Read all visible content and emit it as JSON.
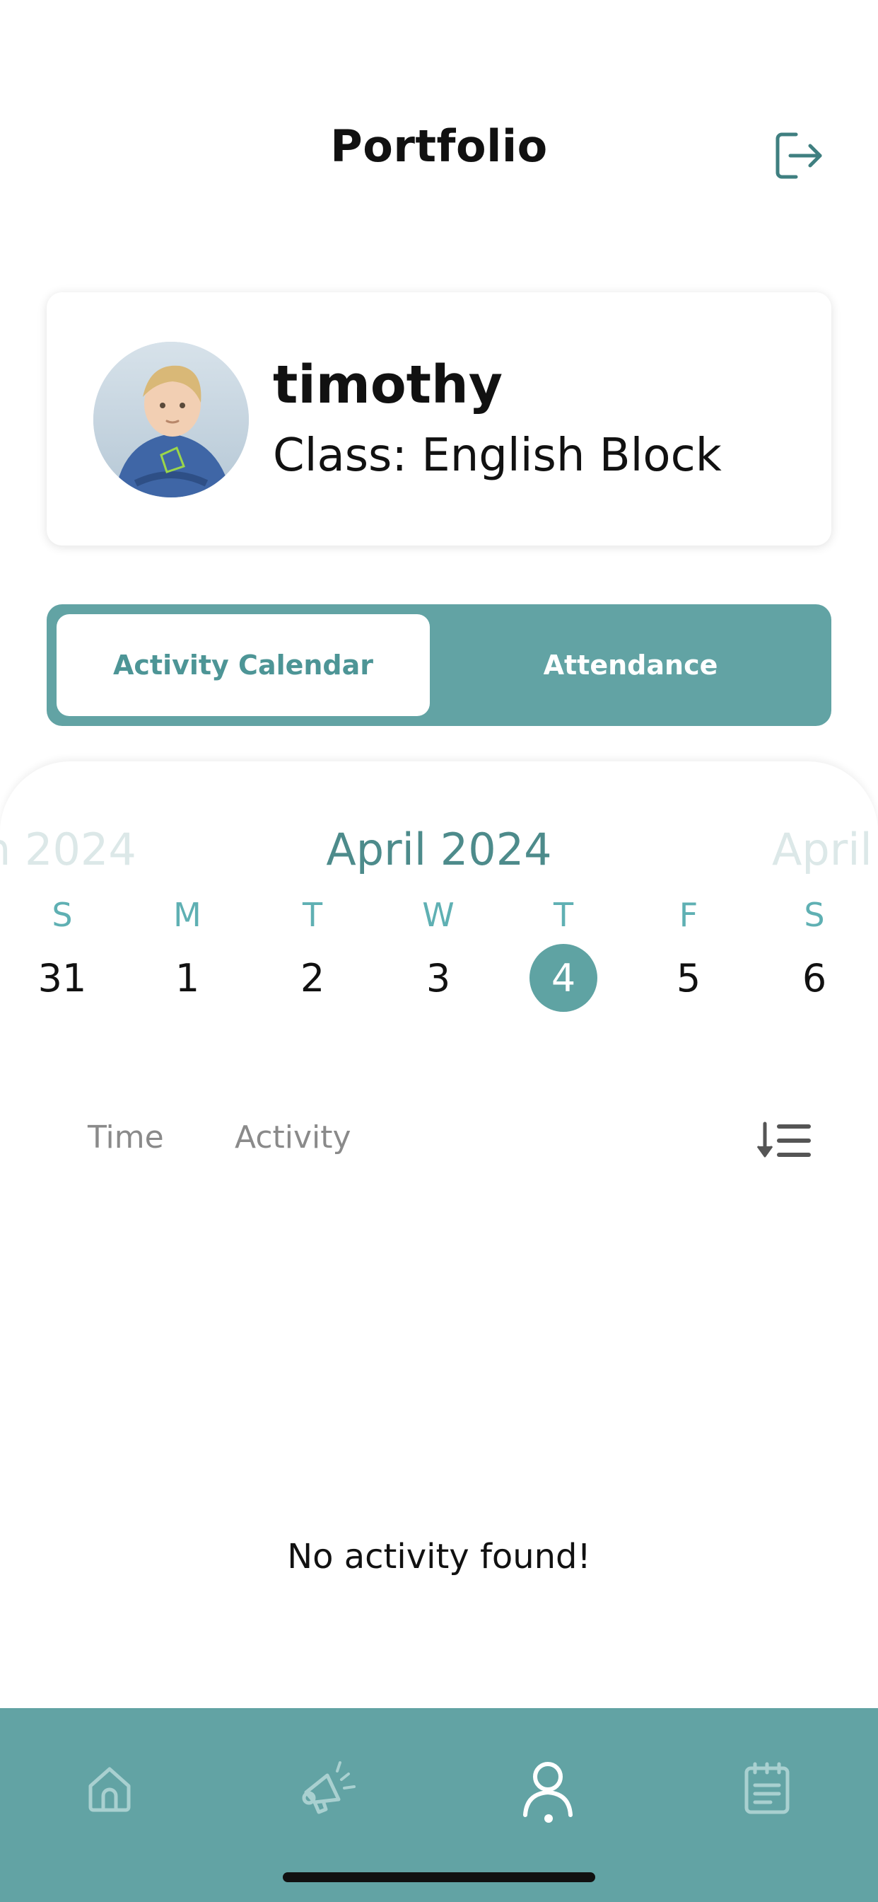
{
  "header": {
    "title": "Portfolio",
    "logout_icon": "logout-icon"
  },
  "profile": {
    "name": "timothy",
    "class_line": "Class: English Block",
    "avatar": "student-avatar"
  },
  "tabs": [
    {
      "label": "Activity Calendar",
      "active": true
    },
    {
      "label": "Attendance",
      "active": false
    }
  ],
  "calendar": {
    "prev_month_label": "h 2024",
    "current_month_label": "April 2024",
    "next_month_label": "April",
    "weekdays": [
      "S",
      "M",
      "T",
      "W",
      "T",
      "F",
      "S"
    ],
    "dates": [
      "31",
      "1",
      "2",
      "3",
      "4",
      "5",
      "6"
    ],
    "selected_date": "4"
  },
  "activity_list": {
    "col_time": "Time",
    "col_activity": "Activity",
    "sort_icon": "sort-descending-icon",
    "empty_message": "No activity found!"
  },
  "bottom_nav": {
    "items": [
      {
        "icon": "home-icon",
        "active": false
      },
      {
        "icon": "megaphone-icon",
        "active": false
      },
      {
        "icon": "user-icon",
        "active": true
      },
      {
        "icon": "notepad-icon",
        "active": false
      }
    ]
  },
  "colors": {
    "accent": "#62a3a4",
    "accent_dark": "#4d8b8b",
    "weekday_text": "#5fb0b3",
    "faded_month": "#dce8e8"
  }
}
